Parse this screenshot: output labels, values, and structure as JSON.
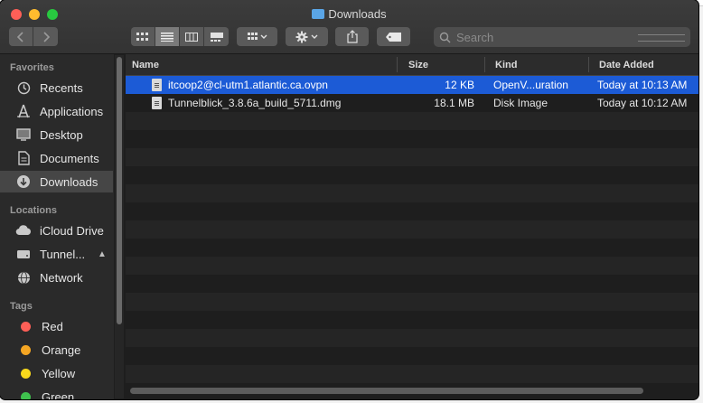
{
  "window": {
    "title": "Downloads"
  },
  "toolbar": {
    "view_modes": [
      "icon-view",
      "list-view",
      "column-view",
      "gallery-view"
    ],
    "active_view": "list-view"
  },
  "search": {
    "placeholder": "Search"
  },
  "sidebar": {
    "favorites_header": "Favorites",
    "favorites": [
      {
        "label": "Recents",
        "icon": "clock-icon"
      },
      {
        "label": "Applications",
        "icon": "applications-icon"
      },
      {
        "label": "Desktop",
        "icon": "desktop-icon"
      },
      {
        "label": "Documents",
        "icon": "document-icon"
      },
      {
        "label": "Downloads",
        "icon": "download-icon",
        "active": true
      }
    ],
    "locations_header": "Locations",
    "locations": [
      {
        "label": "iCloud Drive",
        "icon": "cloud-icon"
      },
      {
        "label": "Tunnel...",
        "icon": "drive-icon",
        "ejectable": true
      },
      {
        "label": "Network",
        "icon": "globe-icon"
      }
    ],
    "tags_header": "Tags",
    "tags": [
      {
        "label": "Red",
        "color": "#ff5f57"
      },
      {
        "label": "Orange",
        "color": "#f5a623"
      },
      {
        "label": "Yellow",
        "color": "#f8d81c"
      },
      {
        "label": "Green",
        "color": "#3fc24e"
      }
    ]
  },
  "columns": {
    "name": "Name",
    "size": "Size",
    "kind": "Kind",
    "date": "Date Added"
  },
  "files": [
    {
      "name": "itcoop2@cl-utm1.atlantic.ca.ovpn",
      "size": "12 KB",
      "kind": "OpenV...uration",
      "date": "Today at 10:13 AM",
      "selected": true
    },
    {
      "name": "Tunnelblick_3.8.6a_build_5711.dmg",
      "size": "18.1 MB",
      "kind": "Disk Image",
      "date": "Today at 10:12 AM",
      "selected": false
    }
  ],
  "colors": {
    "selection": "#1c5bd6",
    "sidebar_active": "#464646"
  }
}
